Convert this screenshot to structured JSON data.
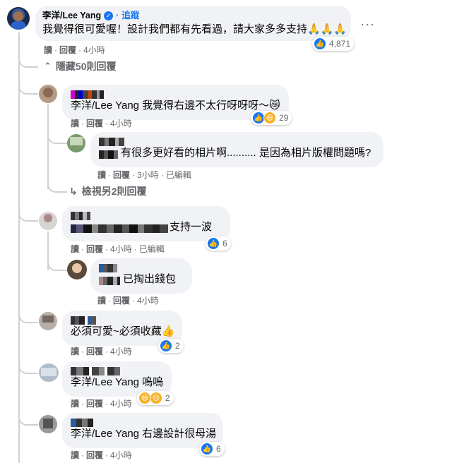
{
  "top": {
    "author": "李洋/Lee Yang",
    "follow": "追蹤",
    "text": "我覺得很可愛喔！設計我們都有先看過，請大家多多支持🙏🙏🙏",
    "reaction_count": "4,871",
    "actions": [
      "讀",
      "回覆",
      "4小時"
    ],
    "more": "···"
  },
  "hidden_replies": "隱藏50則回覆",
  "comments": [
    {
      "text": "李洋/Lee Yang 我覺得右邊不太行呀呀呀～😿",
      "reaction_count": "29",
      "actions": [
        "讀",
        "回覆",
        "4小時"
      ]
    },
    {
      "text": "有很多更好看的相片啊.......... 是因為相片版權問題嗎?",
      "actions": [
        "讀",
        "回覆",
        "3小時",
        "已編輯"
      ]
    },
    {
      "view_more": "檢視另2則回覆"
    },
    {
      "text": "支持一波",
      "reaction_count": "6",
      "actions": [
        "讀",
        "回覆",
        "4小時",
        "已編輯"
      ]
    },
    {
      "text": "已掏出錢包",
      "actions": [
        "讀",
        "回覆",
        "4小時"
      ]
    },
    {
      "text": "必須可愛~必須收藏👍",
      "reaction_count": "2",
      "actions": [
        "讀",
        "回覆",
        "4小時"
      ]
    },
    {
      "text": "李洋/Lee Yang 嗚嗚",
      "reaction_count": "2",
      "actions": [
        "讀",
        "回覆",
        "4小時"
      ]
    },
    {
      "text": "李洋/Lee Yang 右邊設計很母湯",
      "reaction_count": "6",
      "actions": [
        "讀",
        "回覆",
        "4小時"
      ]
    }
  ],
  "colors": {
    "like": "#1877f2",
    "bubble": "#f0f2f5",
    "meta": "#65676b"
  },
  "icons": [
    "like-icon",
    "haha-icon",
    "verified-icon",
    "chevron-up-icon",
    "reply-arrow-icon"
  ]
}
